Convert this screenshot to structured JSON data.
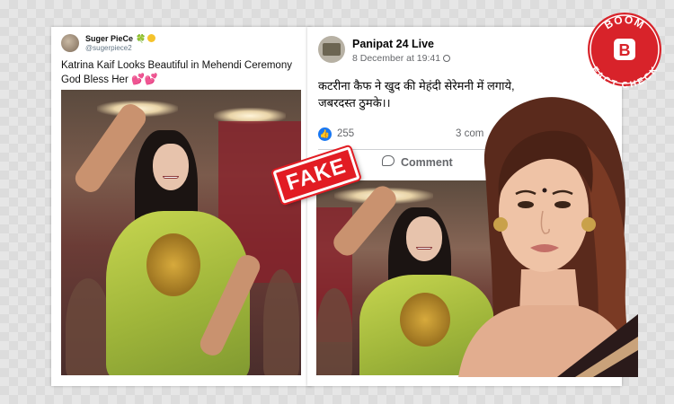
{
  "tweet": {
    "display_name": "Suger PieCe",
    "handle": "@sugerpiece2",
    "text": "Katrina Kaif Looks Beautiful in Mehendi Ceremony God Bless Her",
    "emoji_clover": "🍀",
    "hearts": "💕💕"
  },
  "facebook_post": {
    "page_name": "Panipat 24 Live",
    "timestamp": "8 December at 19:41",
    "text_line1": "कटरीना कैफ ने खुद की मेहंदी सेरेमनी में लगाये,",
    "text_line2": "जबरदस्त ठुमके।।",
    "like_count": "255",
    "comment_count": "3 com",
    "comment_label": "Comment",
    "like_icon": "thumbs-up-icon",
    "comment_icon": "speech-bubble-icon"
  },
  "stamp": {
    "label": "FAKE"
  },
  "badge": {
    "top_text": "BOOM",
    "letter": "B",
    "bottom_text": "FACT CHECK"
  },
  "colors": {
    "facebook_blue": "#1877f2",
    "stamp_red": "#e21c23",
    "badge_red": "#d8232a",
    "saree_green": "#b6c947"
  }
}
